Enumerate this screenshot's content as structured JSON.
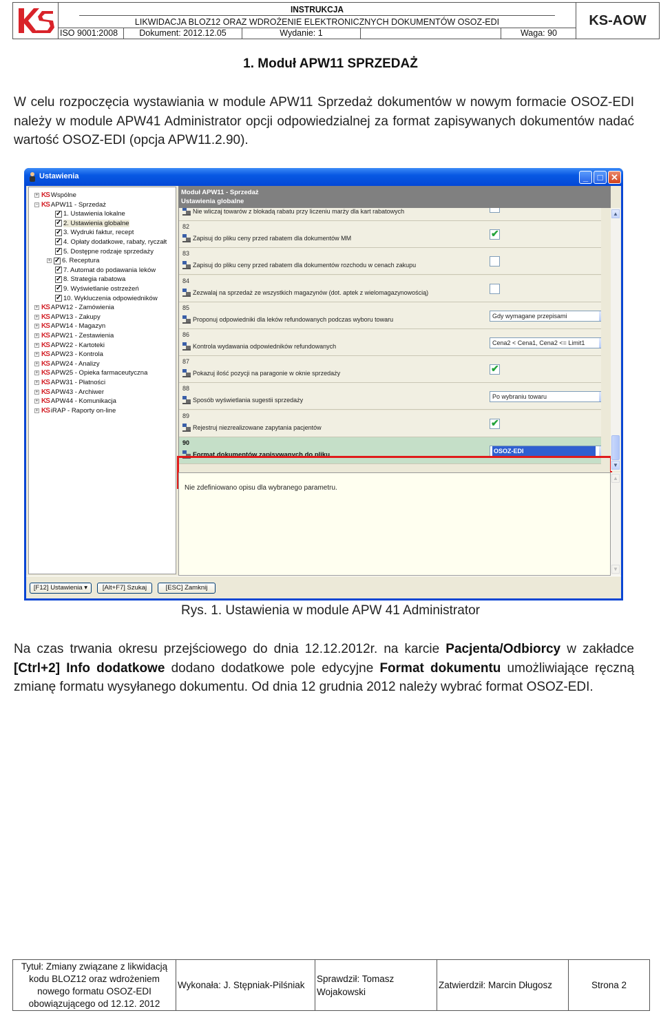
{
  "header": {
    "logo": "KS",
    "doc_type": "INSTRUKCJA",
    "doc_title": "LIKWIDACJA BLOZ12 ORAZ WDROŻENIE ELEKTRONICZNYCH DOKUMENTÓW OSOZ-EDI",
    "iso": "ISO 9001:2008",
    "document": "Dokument: 2012.12.05",
    "edition": "Wydanie: 1",
    "empty_cell": "",
    "weight": "Waga: 90",
    "code": "KS-AOW"
  },
  "section_title": "1. Moduł APW11 SPRZEDAŻ",
  "intro_paragraph": "W celu rozpoczęcia wystawiania w module APW11 Sprzedaż dokumentów w nowym formacie OSOZ-EDI należy w module APW41 Administrator opcji odpowiedzialnej za format zapisywanych dokumentów nadać wartość OSOZ-EDI (opcja APW11.2.90).",
  "window": {
    "title": "Ustawienia",
    "controls": {
      "minimize": "_",
      "maximize": "□",
      "close": "✕"
    },
    "tree": [
      {
        "label": "Wspólne",
        "level": 0,
        "type": "module",
        "expander": "+"
      },
      {
        "label": "APW11 - Sprzedaż",
        "level": 0,
        "type": "module",
        "expander": "−"
      },
      {
        "label": "1. Ustawienia lokalne",
        "level": 1,
        "type": "check"
      },
      {
        "label": "2. Ustawienia globalne",
        "level": 1,
        "type": "check",
        "selected": true
      },
      {
        "label": "3. Wydruki faktur, recept",
        "level": 1,
        "type": "check"
      },
      {
        "label": "4. Opłaty dodatkowe, rabaty, ryczałt",
        "level": 1,
        "type": "check"
      },
      {
        "label": "5. Dostępne rodzaje sprzedaży",
        "level": 1,
        "type": "check"
      },
      {
        "label": "6. Receptura",
        "level": 1,
        "type": "check",
        "expander": "+"
      },
      {
        "label": "7. Automat do podawania leków",
        "level": 1,
        "type": "check"
      },
      {
        "label": "8. Strategia rabatowa",
        "level": 1,
        "type": "check"
      },
      {
        "label": "9. Wyświetlanie ostrzeżeń",
        "level": 1,
        "type": "check"
      },
      {
        "label": "10. Wykluczenia odpowiedników",
        "level": 1,
        "type": "check"
      },
      {
        "label": "APW12 - Zamówienia",
        "level": 0,
        "type": "module",
        "expander": "+"
      },
      {
        "label": "APW13 - Zakupy",
        "level": 0,
        "type": "module",
        "expander": "+"
      },
      {
        "label": "APW14 - Magazyn",
        "level": 0,
        "type": "module",
        "expander": "+"
      },
      {
        "label": "APW21 - Zestawienia",
        "level": 0,
        "type": "module",
        "expander": "+"
      },
      {
        "label": "APW22 - Kartoteki",
        "level": 0,
        "type": "module",
        "expander": "+"
      },
      {
        "label": "APW23 - Kontrola",
        "level": 0,
        "type": "module",
        "expander": "+"
      },
      {
        "label": "APW24 - Analizy",
        "level": 0,
        "type": "module",
        "expander": "+"
      },
      {
        "label": "APW25 - Opieka farmaceutyczna",
        "level": 0,
        "type": "module",
        "expander": "+"
      },
      {
        "label": "APW31 - Płatności",
        "level": 0,
        "type": "module",
        "expander": "+"
      },
      {
        "label": "APW43 - Archiwer",
        "level": 0,
        "type": "module",
        "expander": "+"
      },
      {
        "label": "APW44 - Komunikacja",
        "level": 0,
        "type": "module",
        "expander": "+"
      },
      {
        "label": "iRAP - Raporty on-line",
        "level": 0,
        "type": "module",
        "expander": "+"
      }
    ],
    "panel_header": {
      "line1": "Moduł APW11 - Sprzedaż",
      "line2": "Ustawienia globalne"
    },
    "params": [
      {
        "num": "",
        "desc": "Nie wliczaj towarów z blokadą rabatu przy liczeniu marży dla kart rabatowych",
        "control": "checkbox",
        "checked": false
      },
      {
        "num": "82",
        "desc": "Zapisuj do pliku ceny przed rabatem dla dokumentów MM",
        "control": "checkbox",
        "checked": true
      },
      {
        "num": "83",
        "desc": "Zapisuj do pliku ceny przed rabatem dla dokumentów rozchodu w cenach zakupu",
        "control": "checkbox",
        "checked": false
      },
      {
        "num": "84",
        "desc": "Zezwalaj na sprzedaż ze wszystkich magazynów (dot. aptek z wielomagazynowością)",
        "control": "checkbox",
        "checked": false
      },
      {
        "num": "85",
        "desc": "Proponuj odpowiedniki dla leków refundowanych podczas wyboru towaru",
        "control": "select",
        "value": "Gdy wymagane przepisami"
      },
      {
        "num": "86",
        "desc": "Kontrola wydawania odpowiedników refundowanych",
        "control": "select",
        "value": "Cena2 < Cena1, Cena2 <= Limit1"
      },
      {
        "num": "87",
        "desc": "Pokazuj ilość pozycji na paragonie w oknie sprzedaży",
        "control": "checkbox",
        "checked": true
      },
      {
        "num": "88",
        "desc": "Sposób wyświetlania sugestii sprzedaży",
        "control": "select",
        "value": "Po wybraniu towaru"
      },
      {
        "num": "89",
        "desc": "Rejestruj niezrealizowane zapytania pacjentów",
        "control": "checkbox",
        "checked": true
      },
      {
        "num": "90",
        "desc": "Format dokumentów zapisywanych do pliku",
        "control": "select",
        "value": "OSOZ-EDI",
        "highlighted": true
      }
    ],
    "description": "Nie zdefiniowano opisu dla wybranego parametru.",
    "buttons": {
      "settings": "[F12] Ustawienia ▾",
      "search": "[Alt+F7] Szukaj",
      "close": "[ESC] Zamknij"
    }
  },
  "figure_caption": "Rys. 1. Ustawienia w module APW 41 Administrator",
  "second_paragraph": {
    "t1": "Na czas trwania okresu przejściowego do dnia 12.12.2012r. na karcie ",
    "b1": "Pacjenta/Odbiorcy",
    "t2": " w zakładce ",
    "b2": "[Ctrl+2] Info dodatkowe",
    "t3": " dodano dodatkowe pole edycyjne ",
    "b3": "Format dokumentu",
    "t4": " umożliwiające ręczną zmianę formatu wysyłanego dokumentu. Od dnia 12 grudnia 2012 należy wybrać format OSOZ-EDI."
  },
  "footer": {
    "title": "Tytuł:  Zmiany związane z likwidacją kodu BLOZ12 oraz wdrożeniem nowego formatu OSOZ-EDI obowiązującego od 12.12. 2012",
    "made_by": "Wykonała: J. Stępniak-Pilśniak",
    "checked_by": "Sprawdził: Tomasz Wojakowski",
    "approved_by": "Zatwierdził: Marcin Długosz",
    "page": "Strona 2"
  }
}
